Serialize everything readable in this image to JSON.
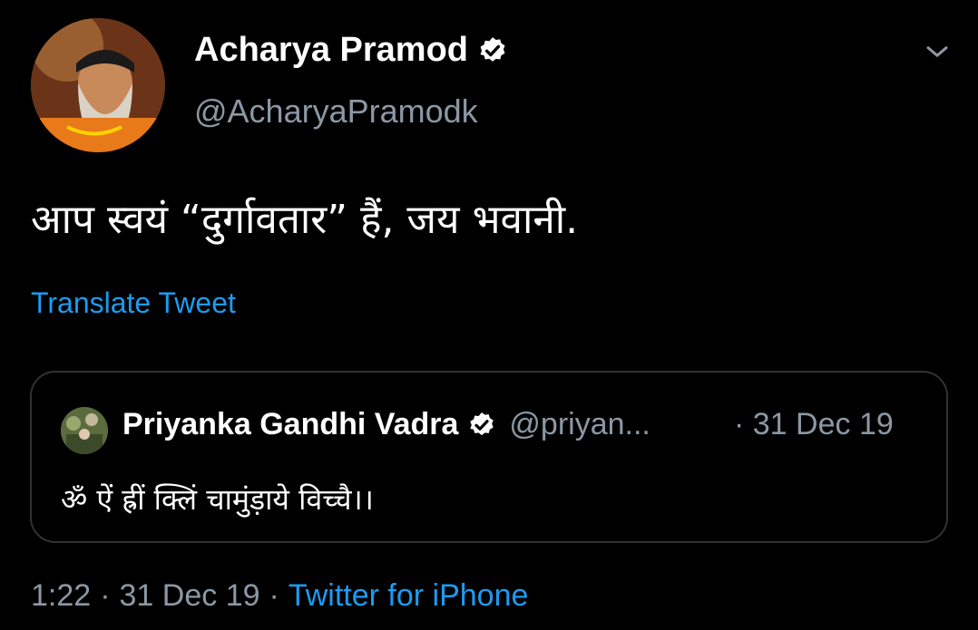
{
  "tweet": {
    "author": {
      "name": "Acharya Pramod",
      "handle": "@AcharyaPramodk",
      "verified": true
    },
    "text": "आप स्वयं “दुर्गावतार” हैं, जय भवानी.",
    "translate_label": "Translate Tweet",
    "time": "1:22",
    "separator": "·",
    "date": "31 Dec 19",
    "source": "Twitter for iPhone"
  },
  "quoted_tweet": {
    "author": {
      "name": "Priyanka Gandhi Vadra",
      "handle": "@priyan...",
      "verified": true
    },
    "date": "· 31 Dec 19",
    "text": "ॐ ऐं ह्रीं क्लिं चामुंड़ाये विच्चै।।"
  },
  "colors": {
    "background": "#000000",
    "text": "#ffffff",
    "secondary": "#8b98a5",
    "accent": "#1d9bf0",
    "border": "#2f3336"
  },
  "icons": {
    "verified": "verified-badge-icon",
    "menu": "chevron-down-icon"
  }
}
